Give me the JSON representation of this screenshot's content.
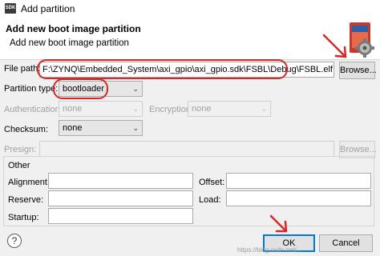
{
  "window": {
    "title": "Add partition",
    "icon_text": "SDK"
  },
  "header": {
    "title": "Add new boot image partition",
    "description": "Add new boot image partition"
  },
  "file_path": {
    "label": "File path:",
    "value": "F:\\ZYNQ\\Embedded_System\\axi_gpio\\axi_gpio.sdk\\FSBL\\Debug\\FSBL.elf",
    "browse_label": "Browse..."
  },
  "partition_type": {
    "label": "Partition type:",
    "value": "bootloader"
  },
  "authentication": {
    "label": "Authentication:",
    "value": "none"
  },
  "encryption": {
    "label": "Encryption:",
    "value": "none"
  },
  "checksum": {
    "label": "Checksum:",
    "value": "none"
  },
  "presign": {
    "label": "Presign:",
    "value": "",
    "browse_label": "Browse..."
  },
  "other": {
    "legend": "Other",
    "alignment_label": "Alignment:",
    "alignment_value": "",
    "offset_label": "Offset:",
    "offset_value": "",
    "reserve_label": "Reserve:",
    "reserve_value": "",
    "load_label": "Load:",
    "load_value": "",
    "startup_label": "Startup:",
    "startup_value": ""
  },
  "buttons": {
    "ok": "OK",
    "cancel": "Cancel",
    "help": "?"
  },
  "watermark": "https://blog.csdn.net/...",
  "colors": {
    "annotation_red": "#d62828",
    "default_button_border": "#0078d7"
  }
}
